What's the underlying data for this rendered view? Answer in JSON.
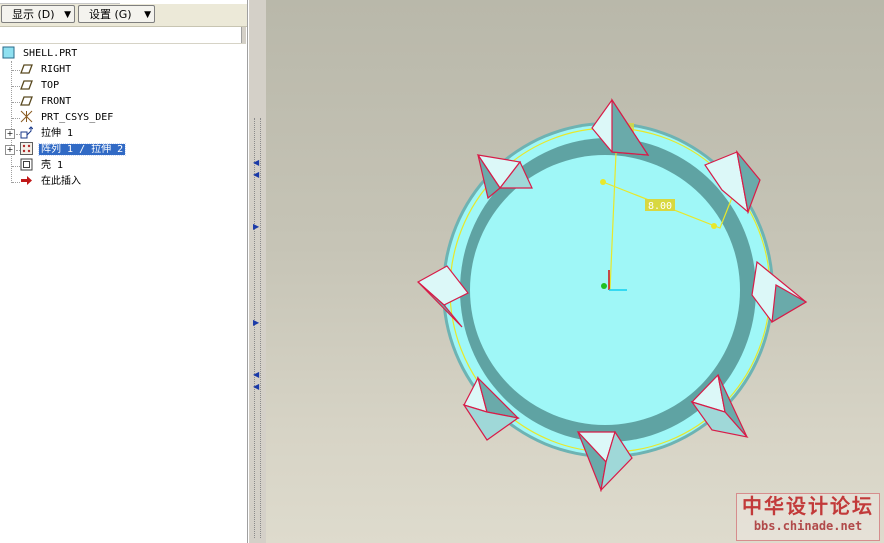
{
  "toolbar": {
    "display_label": "显示 (D)",
    "settings_label": "设置 (G)",
    "dropdown_arrow": "▼"
  },
  "model_tree": {
    "root": {
      "label": "SHELL.PRT",
      "icon": "part-icon"
    },
    "items": [
      {
        "label": "RIGHT",
        "icon": "datum-plane-icon"
      },
      {
        "label": "TOP",
        "icon": "datum-plane-icon"
      },
      {
        "label": "FRONT",
        "icon": "datum-plane-icon"
      },
      {
        "label": "PRT_CSYS_DEF",
        "icon": "csys-icon"
      },
      {
        "label": "拉伸 1",
        "icon": "extrude-icon",
        "expandable": true
      },
      {
        "label": "阵列 1 / 拉伸 2",
        "icon": "pattern-icon",
        "expandable": true,
        "selected": true
      },
      {
        "label": "壳 1",
        "icon": "shell-icon"
      },
      {
        "label": "在此插入",
        "icon": "insert-here-arrow-icon"
      }
    ]
  },
  "viewport": {
    "dimension_label": "8.00",
    "colors": {
      "body_light": "#9ff7f7",
      "body_dark": "#5fa3a3",
      "edge_highlight": "#e0204a",
      "sketch_yellow": "#e8e82a"
    }
  },
  "watermark": {
    "title": "中华设计论坛",
    "url": "bbs.chinade.net"
  }
}
